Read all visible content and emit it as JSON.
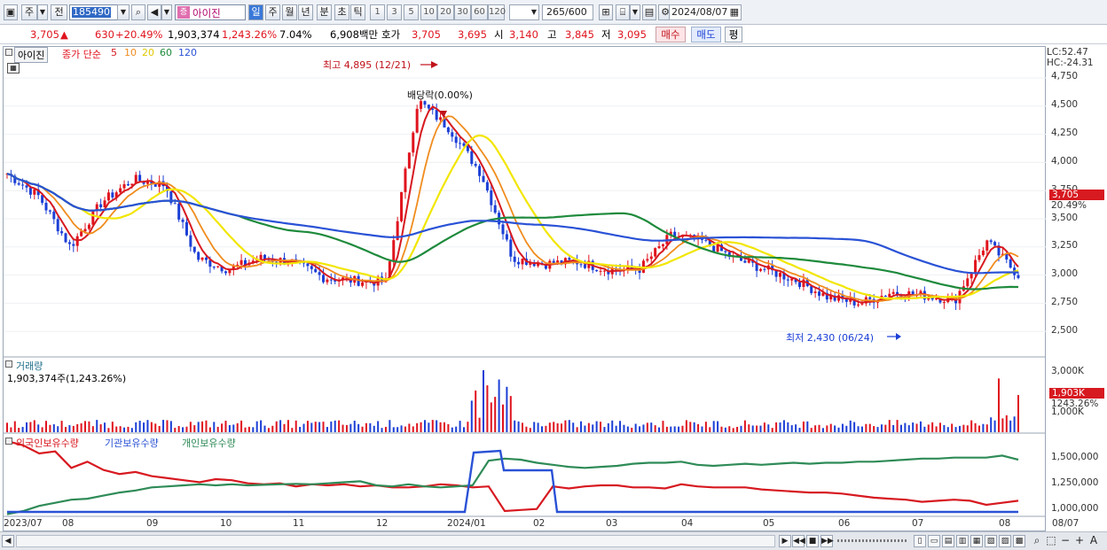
{
  "toolbar": {
    "market_btn": "주",
    "prev_btn": "전",
    "stock_code": "185490",
    "stock_name": "아이진",
    "period_buttons": [
      "일",
      "주",
      "월",
      "년",
      "분",
      "초",
      "틱"
    ],
    "minute_buttons": [
      "1",
      "3",
      "5",
      "10",
      "20",
      "30",
      "60",
      "120"
    ],
    "count_current": "265",
    "count_total": "/600",
    "date_value": "2024/08/07"
  },
  "quote": {
    "price": "3,705",
    "arrow": "▲",
    "change": "630",
    "change_pct": "+20.49%",
    "volume": "1,903,374",
    "volume_pct": "1,243.26%",
    "turnover": "7.04%",
    "trade_value": "6,908백만",
    "bid_label": "호가",
    "ask_price": "3,705",
    "bid_price": "3,695",
    "open_label": "시",
    "open": "3,140",
    "high_label": "고",
    "high": "3,845",
    "low_label": "저",
    "low": "3,095",
    "buy_btn": "매수",
    "sell_btn": "매도",
    "eval_btn": "평"
  },
  "price_pane": {
    "stock_tag": "아이진",
    "legend_prefix": "종가 단순",
    "ma_labels": [
      "5",
      "10",
      "20",
      "60",
      "120"
    ],
    "ma_colors": [
      "#d71920",
      "#f08c1e",
      "#f2e600",
      "#1e8a3c",
      "#2a52d6"
    ],
    "lc_label": "LC:52.47",
    "hc_label": "HC:-24.31",
    "annotation_high": "최고 4,895 (12/21)",
    "annotation_dividend": "배당락(0.00%)",
    "annotation_low": "최저 2,430 (06/24)",
    "y_ticks": [
      "4,750",
      "4,500",
      "4,250",
      "4,000",
      "3,750",
      "3,500",
      "3,250",
      "3,000",
      "2,750",
      "2,500"
    ],
    "current_price_tag": "3,705",
    "current_change_tag": "20.49%"
  },
  "volume_pane": {
    "title": "거래량",
    "value_text": "1,903,374주(1,243.26%)",
    "y_ticks": [
      "3,000K",
      "1,000K"
    ],
    "volume_tag": "1,903K",
    "volume_pct_tag": "1243.26%"
  },
  "holding_pane": {
    "legend": [
      "외국인보유수량",
      "기관보유수량",
      "개인보유수량"
    ],
    "colors": [
      "#d71920",
      "#2a52d6",
      "#2e8b57"
    ],
    "y_ticks": [
      "1,500,000",
      "1,250,000",
      "1,000,000"
    ]
  },
  "x_axis": {
    "labels": [
      "2023/07",
      "08",
      "09",
      "10",
      "11",
      "12",
      "2024/01",
      "02",
      "03",
      "04",
      "05",
      "06",
      "07",
      "08",
      "08/07"
    ]
  },
  "chart_data": {
    "type": "line",
    "title": "아이진",
    "series": [
      {
        "name": "종가 단순 5",
        "color": "#d71920",
        "values": [
          3900,
          3700,
          3250,
          3650,
          3850,
          3800,
          3150,
          3050,
          3150,
          3120,
          2980,
          2950,
          2940,
          4550,
          4300,
          3900,
          3150,
          3100,
          3120,
          3050,
          3050,
          3350,
          3300,
          3150,
          3050,
          2950,
          2800,
          2750,
          2850,
          2820,
          2780,
          3300,
          3000
        ]
      },
      {
        "name": "종가 단순 10",
        "color": "#f08c1e"
      },
      {
        "name": "종가 단순 20",
        "color": "#f2e600"
      },
      {
        "name": "종가 단순 60",
        "color": "#1e8a3c"
      },
      {
        "name": "종가 단순 120",
        "color": "#2a52d6"
      },
      {
        "name": "외국인보유수량",
        "color": "#d71920"
      },
      {
        "name": "기관보유수량",
        "color": "#2a52d6"
      },
      {
        "name": "개인보유수량",
        "color": "#2e8b57"
      }
    ],
    "ylim": [
      2400,
      4850
    ],
    "high": {
      "value": 4895,
      "date": "12/21"
    },
    "low": {
      "value": 2430,
      "date": "06/24"
    }
  }
}
